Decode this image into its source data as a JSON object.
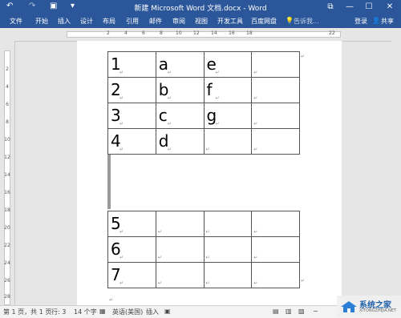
{
  "title_bar": {
    "title": "新建 Microsoft Word 文档.docx - Word",
    "undo": "↶",
    "redo": "↷",
    "save": "▣",
    "customize": "▾",
    "restore": "⧉",
    "minimize": "—",
    "maximize": "☐",
    "close": "✕"
  },
  "ribbon": {
    "tabs": [
      "文件",
      "开始",
      "插入",
      "设计",
      "布局",
      "引用",
      "邮件",
      "审阅",
      "视图",
      "开发工具",
      "百度网盘"
    ],
    "tell_me": "告诉我...",
    "login": "登录",
    "share": "共享"
  },
  "ruler": {
    "h_numbers": [
      "2",
      "4",
      "6",
      "8",
      "10",
      "12",
      "14",
      "16",
      "18",
      "",
      "22"
    ],
    "v_numbers": [
      "2",
      "4",
      "6",
      "8",
      "10",
      "12",
      "14",
      "16",
      "18",
      "20",
      "22",
      "24",
      "26",
      "28"
    ]
  },
  "table_top": {
    "rows": [
      [
        "1",
        "a",
        "e",
        ""
      ],
      [
        "2",
        "b",
        "f",
        ""
      ],
      [
        "3",
        "c",
        "g",
        ""
      ],
      [
        "4",
        "d",
        "",
        ""
      ]
    ]
  },
  "table_bottom": {
    "rows": [
      [
        "5",
        "",
        "",
        ""
      ],
      [
        "6",
        "",
        "",
        ""
      ],
      [
        "7",
        "",
        "",
        ""
      ]
    ]
  },
  "paragraph_mark": "↵",
  "status": {
    "page": "第 1 页，共 1 页",
    "lines": "行: 3",
    "words": "14 个字",
    "lang": "英语(美国)",
    "mode": "插入"
  },
  "watermark": {
    "site": "系统之家",
    "url": "XITONGZHIJIA.NET"
  }
}
